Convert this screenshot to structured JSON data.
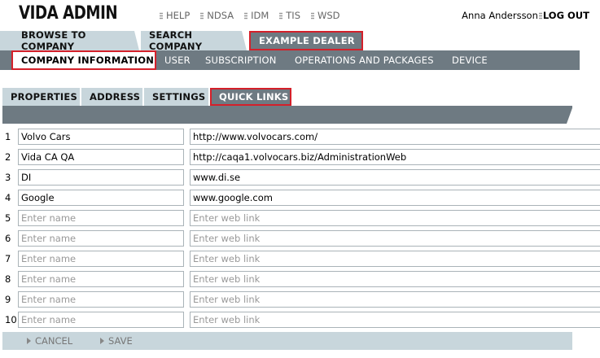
{
  "app": {
    "logo": "VIDA ADMIN"
  },
  "topnav": {
    "items": [
      "HELP",
      "NDSA",
      "IDM",
      "TIS",
      "WSD"
    ]
  },
  "user": {
    "name": "Anna Andersson",
    "logout": "LOG OUT"
  },
  "tabs_primary": [
    "BROWSE TO COMPANY",
    "SEARCH COMPANY",
    "EXAMPLE DEALER"
  ],
  "subnav": [
    "COMPANY INFORMATION",
    "USER",
    "SUBSCRIPTION",
    "OPERATIONS AND PACKAGES",
    "DEVICE"
  ],
  "tabs_secondary": [
    "PROPERTIES",
    "ADDRESS",
    "SETTINGS",
    "QUICK LINKS"
  ],
  "quick_links": {
    "name_placeholder": "Enter name",
    "link_placeholder": "Enter web link",
    "rows": [
      {
        "num": "1",
        "name": "Volvo Cars",
        "link": "http://www.volvocars.com/"
      },
      {
        "num": "2",
        "name": "Vida CA QA",
        "link": "http://caqa1.volvocars.biz/AdministrationWeb"
      },
      {
        "num": "3",
        "name": "DI",
        "link": "www.di.se"
      },
      {
        "num": "4",
        "name": "Google",
        "link": "www.google.com"
      },
      {
        "num": "5",
        "name": "",
        "link": ""
      },
      {
        "num": "6",
        "name": "",
        "link": ""
      },
      {
        "num": "7",
        "name": "",
        "link": ""
      },
      {
        "num": "8",
        "name": "",
        "link": ""
      },
      {
        "num": "9",
        "name": "",
        "link": ""
      },
      {
        "num": "10",
        "name": "",
        "link": ""
      }
    ]
  },
  "actions": {
    "cancel": "CANCEL",
    "save": "SAVE"
  },
  "colors": {
    "highlight": "#d4202a",
    "tab_light": "#c8d6dc",
    "tab_dark": "#6e7a82"
  }
}
